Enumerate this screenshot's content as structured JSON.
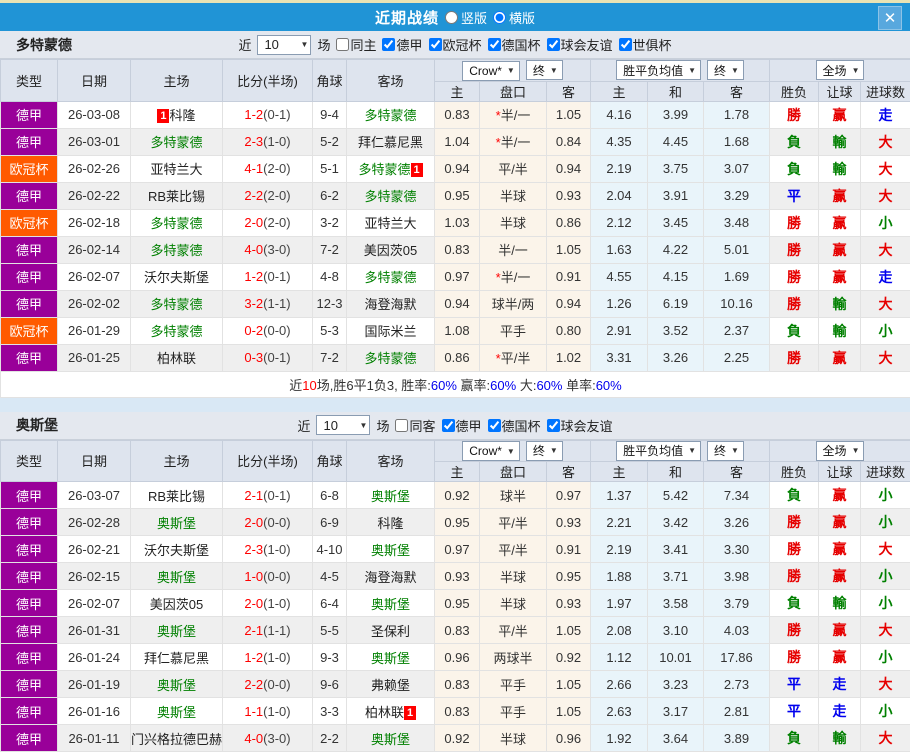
{
  "titlebar": {
    "title": "近期战绩",
    "radio_vertical": "竖版",
    "radio_horizontal": "横版",
    "close_glyph": "✕"
  },
  "colors": {
    "bundesliga": "#990099",
    "champions_league": "#ff5a00",
    "titlebar_blue": "#2094d6",
    "score_red": "#ff0000",
    "team_green": "#008000",
    "blue_text": "#0000ee"
  },
  "table_header": {
    "main_cols": [
      "类型",
      "日期",
      "主场",
      "比分(半场)",
      "角球",
      "客场"
    ],
    "sub_cols": [
      "主",
      "盘口",
      "客",
      "主",
      "和",
      "客",
      "胜负",
      "让球",
      "进球数"
    ],
    "select_crown": "Crow*",
    "select_final1": "终",
    "select_avg": "胜平负均值",
    "select_final2": "终",
    "select_fullmatch": "全场"
  },
  "filter_words": {
    "near": "近",
    "count": "10",
    "unit": "场"
  },
  "sections": [
    {
      "team": "多特蒙德",
      "same_filter": {
        "label": "同主",
        "checked": false
      },
      "leagues": [
        {
          "label": "德甲",
          "checked": true
        },
        {
          "label": "欧冠杯",
          "checked": true
        },
        {
          "label": "德国杯",
          "checked": true
        },
        {
          "label": "球会友谊",
          "checked": true
        },
        {
          "label": "世俱杯",
          "checked": true
        }
      ],
      "rows": [
        {
          "league": "德甲",
          "lc": "#990099",
          "date": "26-03-08",
          "home": {
            "name": "科隆",
            "green": false,
            "card_pre": "1"
          },
          "score": "1-2",
          "half": "(0-1)",
          "corner": "9-4",
          "away": {
            "name": "多特蒙德",
            "green": true
          },
          "odds": [
            "0.83",
            "*半/一",
            "1.05"
          ],
          "avg": [
            "4.16",
            "3.99",
            "1.78"
          ],
          "res": [
            [
              "勝",
              "r"
            ],
            [
              "赢",
              "r"
            ],
            [
              "走",
              "b"
            ]
          ]
        },
        {
          "league": "德甲",
          "lc": "#990099",
          "date": "26-03-01",
          "home": {
            "name": "多特蒙德",
            "green": true
          },
          "score": "2-3",
          "half": "(1-0)",
          "corner": "5-2",
          "away": {
            "name": "拜仁慕尼黑",
            "green": false
          },
          "odds": [
            "1.04",
            "*半/一",
            "0.84"
          ],
          "avg": [
            "4.35",
            "4.45",
            "1.68"
          ],
          "res": [
            [
              "負",
              "g"
            ],
            [
              "輸",
              "g"
            ],
            [
              "大",
              "r"
            ]
          ]
        },
        {
          "league": "欧冠杯",
          "lc": "#ff5a00",
          "date": "26-02-26",
          "home": {
            "name": "亚特兰大",
            "green": false
          },
          "score": "4-1",
          "half": "(2-0)",
          "corner": "5-1",
          "away": {
            "name": "多特蒙德",
            "green": true,
            "card": "1"
          },
          "odds": [
            "0.94",
            "平/半",
            "0.94"
          ],
          "avg": [
            "2.19",
            "3.75",
            "3.07"
          ],
          "res": [
            [
              "負",
              "g"
            ],
            [
              "輸",
              "g"
            ],
            [
              "大",
              "r"
            ]
          ]
        },
        {
          "league": "德甲",
          "lc": "#990099",
          "date": "26-02-22",
          "home": {
            "name": "RB莱比锡",
            "green": false
          },
          "score": "2-2",
          "half": "(2-0)",
          "corner": "6-2",
          "away": {
            "name": "多特蒙德",
            "green": true
          },
          "odds": [
            "0.95",
            "半球",
            "0.93"
          ],
          "avg": [
            "2.04",
            "3.91",
            "3.29"
          ],
          "res": [
            [
              "平",
              "b"
            ],
            [
              "赢",
              "r"
            ],
            [
              "大",
              "r"
            ]
          ]
        },
        {
          "league": "欧冠杯",
          "lc": "#ff5a00",
          "date": "26-02-18",
          "home": {
            "name": "多特蒙德",
            "green": true
          },
          "score": "2-0",
          "half": "(2-0)",
          "corner": "3-2",
          "away": {
            "name": "亚特兰大",
            "green": false
          },
          "odds": [
            "1.03",
            "半球",
            "0.86"
          ],
          "avg": [
            "2.12",
            "3.45",
            "3.48"
          ],
          "res": [
            [
              "勝",
              "r"
            ],
            [
              "赢",
              "r"
            ],
            [
              "小",
              "g"
            ]
          ]
        },
        {
          "league": "德甲",
          "lc": "#990099",
          "date": "26-02-14",
          "home": {
            "name": "多特蒙德",
            "green": true
          },
          "score": "4-0",
          "half": "(3-0)",
          "corner": "7-2",
          "away": {
            "name": "美因茨05",
            "green": false
          },
          "odds": [
            "0.83",
            "半/一",
            "1.05"
          ],
          "avg": [
            "1.63",
            "4.22",
            "5.01"
          ],
          "res": [
            [
              "勝",
              "r"
            ],
            [
              "赢",
              "r"
            ],
            [
              "大",
              "r"
            ]
          ]
        },
        {
          "league": "德甲",
          "lc": "#990099",
          "date": "26-02-07",
          "home": {
            "name": "沃尔夫斯堡",
            "green": false
          },
          "score": "1-2",
          "half": "(0-1)",
          "corner": "4-8",
          "away": {
            "name": "多特蒙德",
            "green": true
          },
          "odds": [
            "0.97",
            "*半/一",
            "0.91"
          ],
          "avg": [
            "4.55",
            "4.15",
            "1.69"
          ],
          "res": [
            [
              "勝",
              "r"
            ],
            [
              "赢",
              "r"
            ],
            [
              "走",
              "b"
            ]
          ]
        },
        {
          "league": "德甲",
          "lc": "#990099",
          "date": "26-02-02",
          "home": {
            "name": "多特蒙德",
            "green": true
          },
          "score": "3-2",
          "half": "(1-1)",
          "corner": "12-3",
          "away": {
            "name": "海登海默",
            "green": false
          },
          "odds": [
            "0.94",
            "球半/两",
            "0.94"
          ],
          "avg": [
            "1.26",
            "6.19",
            "10.16"
          ],
          "res": [
            [
              "勝",
              "r"
            ],
            [
              "輸",
              "g"
            ],
            [
              "大",
              "r"
            ]
          ]
        },
        {
          "league": "欧冠杯",
          "lc": "#ff5a00",
          "date": "26-01-29",
          "home": {
            "name": "多特蒙德",
            "green": true
          },
          "score": "0-2",
          "half": "(0-0)",
          "corner": "5-3",
          "away": {
            "name": "国际米兰",
            "green": false
          },
          "odds": [
            "1.08",
            "平手",
            "0.80"
          ],
          "avg": [
            "2.91",
            "3.52",
            "2.37"
          ],
          "res": [
            [
              "負",
              "g"
            ],
            [
              "輸",
              "g"
            ],
            [
              "小",
              "g"
            ]
          ]
        },
        {
          "league": "德甲",
          "lc": "#990099",
          "date": "26-01-25",
          "home": {
            "name": "柏林联",
            "green": false
          },
          "score": "0-3",
          "half": "(0-1)",
          "corner": "7-2",
          "away": {
            "name": "多特蒙德",
            "green": true
          },
          "odds": [
            "0.86",
            "*平/半",
            "1.02"
          ],
          "avg": [
            "3.31",
            "3.26",
            "2.25"
          ],
          "res": [
            [
              "勝",
              "r"
            ],
            [
              "赢",
              "r"
            ],
            [
              "大",
              "r"
            ]
          ]
        }
      ],
      "summary": [
        {
          "t": "近",
          "c": "dark"
        },
        {
          "t": "10",
          "c": "red"
        },
        {
          "t": "场,胜6平1负3, 胜率:",
          "c": "dark"
        },
        {
          "t": "60%",
          "c": "blue"
        },
        {
          "t": " 赢率:",
          "c": "dark"
        },
        {
          "t": "60%",
          "c": "blue"
        },
        {
          "t": " 大:",
          "c": "dark"
        },
        {
          "t": "60%",
          "c": "blue"
        },
        {
          "t": " 单率:",
          "c": "dark"
        },
        {
          "t": "60%",
          "c": "blue"
        }
      ]
    },
    {
      "team": "奥斯堡",
      "same_filter": {
        "label": "同客",
        "checked": false
      },
      "leagues": [
        {
          "label": "德甲",
          "checked": true
        },
        {
          "label": "德国杯",
          "checked": true
        },
        {
          "label": "球会友谊",
          "checked": true
        }
      ],
      "rows": [
        {
          "league": "德甲",
          "lc": "#990099",
          "date": "26-03-07",
          "home": {
            "name": "RB莱比锡",
            "green": false
          },
          "score": "2-1",
          "half": "(0-1)",
          "corner": "6-8",
          "away": {
            "name": "奥斯堡",
            "green": true
          },
          "odds": [
            "0.92",
            "球半",
            "0.97"
          ],
          "avg": [
            "1.37",
            "5.42",
            "7.34"
          ],
          "res": [
            [
              "負",
              "g"
            ],
            [
              "赢",
              "r"
            ],
            [
              "小",
              "g"
            ]
          ]
        },
        {
          "league": "德甲",
          "lc": "#990099",
          "date": "26-02-28",
          "home": {
            "name": "奥斯堡",
            "green": true
          },
          "score": "2-0",
          "half": "(0-0)",
          "corner": "6-9",
          "away": {
            "name": "科隆",
            "green": false
          },
          "odds": [
            "0.95",
            "平/半",
            "0.93"
          ],
          "avg": [
            "2.21",
            "3.42",
            "3.26"
          ],
          "res": [
            [
              "勝",
              "r"
            ],
            [
              "赢",
              "r"
            ],
            [
              "小",
              "g"
            ]
          ]
        },
        {
          "league": "德甲",
          "lc": "#990099",
          "date": "26-02-21",
          "home": {
            "name": "沃尔夫斯堡",
            "green": false
          },
          "score": "2-3",
          "half": "(1-0)",
          "corner": "4-10",
          "away": {
            "name": "奥斯堡",
            "green": true
          },
          "odds": [
            "0.97",
            "平/半",
            "0.91"
          ],
          "avg": [
            "2.19",
            "3.41",
            "3.30"
          ],
          "res": [
            [
              "勝",
              "r"
            ],
            [
              "赢",
              "r"
            ],
            [
              "大",
              "r"
            ]
          ]
        },
        {
          "league": "德甲",
          "lc": "#990099",
          "date": "26-02-15",
          "home": {
            "name": "奥斯堡",
            "green": true
          },
          "score": "1-0",
          "half": "(0-0)",
          "corner": "4-5",
          "away": {
            "name": "海登海默",
            "green": false
          },
          "odds": [
            "0.93",
            "半球",
            "0.95"
          ],
          "avg": [
            "1.88",
            "3.71",
            "3.98"
          ],
          "res": [
            [
              "勝",
              "r"
            ],
            [
              "赢",
              "r"
            ],
            [
              "小",
              "g"
            ]
          ]
        },
        {
          "league": "德甲",
          "lc": "#990099",
          "date": "26-02-07",
          "home": {
            "name": "美因茨05",
            "green": false
          },
          "score": "2-0",
          "half": "(1-0)",
          "corner": "6-4",
          "away": {
            "name": "奥斯堡",
            "green": true
          },
          "odds": [
            "0.95",
            "半球",
            "0.93"
          ],
          "avg": [
            "1.97",
            "3.58",
            "3.79"
          ],
          "res": [
            [
              "負",
              "g"
            ],
            [
              "輸",
              "g"
            ],
            [
              "小",
              "g"
            ]
          ]
        },
        {
          "league": "德甲",
          "lc": "#990099",
          "date": "26-01-31",
          "home": {
            "name": "奥斯堡",
            "green": true
          },
          "score": "2-1",
          "half": "(1-1)",
          "corner": "5-5",
          "away": {
            "name": "圣保利",
            "green": false
          },
          "odds": [
            "0.83",
            "平/半",
            "1.05"
          ],
          "avg": [
            "2.08",
            "3.10",
            "4.03"
          ],
          "res": [
            [
              "勝",
              "r"
            ],
            [
              "赢",
              "r"
            ],
            [
              "大",
              "r"
            ]
          ]
        },
        {
          "league": "德甲",
          "lc": "#990099",
          "date": "26-01-24",
          "home": {
            "name": "拜仁慕尼黑",
            "green": false
          },
          "score": "1-2",
          "half": "(1-0)",
          "corner": "9-3",
          "away": {
            "name": "奥斯堡",
            "green": true
          },
          "odds": [
            "0.96",
            "两球半",
            "0.92"
          ],
          "avg": [
            "1.12",
            "10.01",
            "17.86"
          ],
          "res": [
            [
              "勝",
              "r"
            ],
            [
              "赢",
              "r"
            ],
            [
              "小",
              "g"
            ]
          ]
        },
        {
          "league": "德甲",
          "lc": "#990099",
          "date": "26-01-19",
          "home": {
            "name": "奥斯堡",
            "green": true
          },
          "score": "2-2",
          "half": "(0-0)",
          "corner": "9-6",
          "away": {
            "name": "弗赖堡",
            "green": false
          },
          "odds": [
            "0.83",
            "平手",
            "1.05"
          ],
          "avg": [
            "2.66",
            "3.23",
            "2.73"
          ],
          "res": [
            [
              "平",
              "b"
            ],
            [
              "走",
              "b"
            ],
            [
              "大",
              "r"
            ]
          ]
        },
        {
          "league": "德甲",
          "lc": "#990099",
          "date": "26-01-16",
          "home": {
            "name": "奥斯堡",
            "green": true
          },
          "score": "1-1",
          "half": "(1-0)",
          "corner": "3-3",
          "away": {
            "name": "柏林联",
            "green": false,
            "card": "1"
          },
          "odds": [
            "0.83",
            "平手",
            "1.05"
          ],
          "avg": [
            "2.63",
            "3.17",
            "2.81"
          ],
          "res": [
            [
              "平",
              "b"
            ],
            [
              "走",
              "b"
            ],
            [
              "小",
              "g"
            ]
          ]
        },
        {
          "league": "德甲",
          "lc": "#990099",
          "date": "26-01-11",
          "home": {
            "name": "门兴格拉德巴赫",
            "green": false
          },
          "score": "4-0",
          "half": "(3-0)",
          "corner": "2-2",
          "away": {
            "name": "奥斯堡",
            "green": true
          },
          "odds": [
            "0.92",
            "半球",
            "0.96"
          ],
          "avg": [
            "1.92",
            "3.64",
            "3.89"
          ],
          "res": [
            [
              "負",
              "g"
            ],
            [
              "輸",
              "g"
            ],
            [
              "大",
              "r"
            ]
          ]
        }
      ],
      "summary": null
    }
  ]
}
